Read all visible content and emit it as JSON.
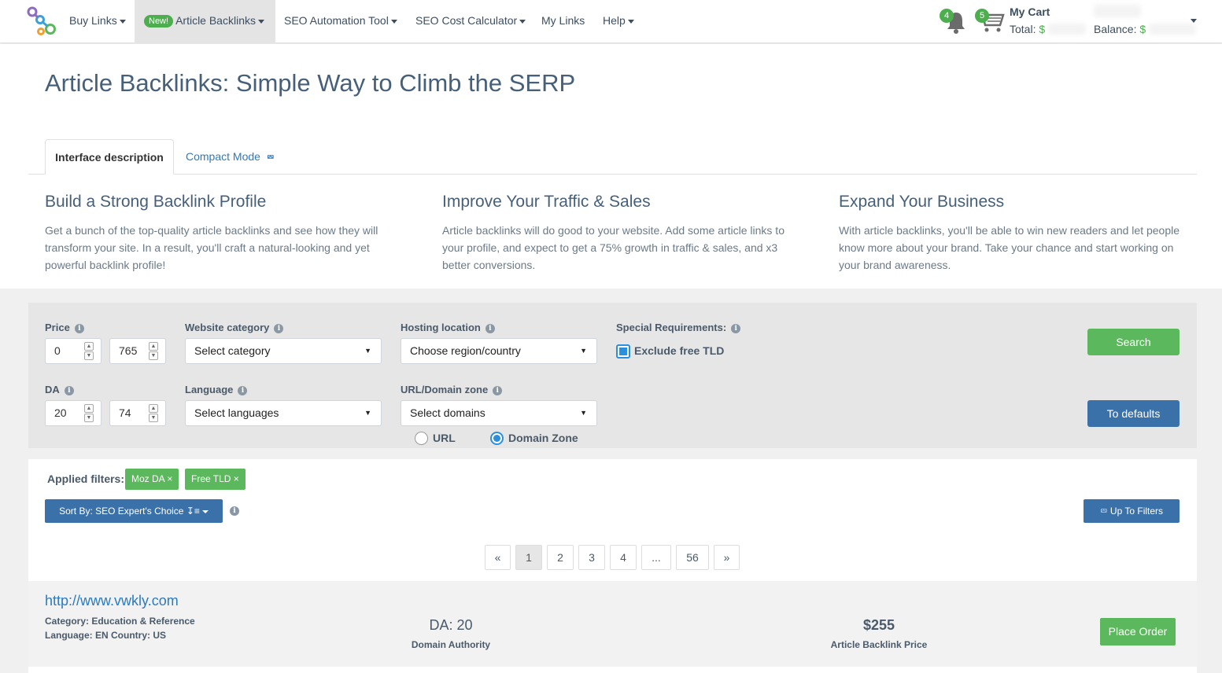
{
  "nav": {
    "items": [
      {
        "label": "Buy Links",
        "dropdown": true
      },
      {
        "badge": "New!",
        "label": "Article Backlinks",
        "dropdown": true,
        "active": true
      },
      {
        "label": "SEO Automation Tool",
        "dropdown": true
      },
      {
        "label": "SEO Cost Calculator",
        "dropdown": true
      },
      {
        "label": "My Links",
        "dropdown": false
      },
      {
        "label": "Help",
        "dropdown": true
      }
    ],
    "notifications_count": "4",
    "cart_count": "5",
    "my_cart": "My Cart",
    "total_label": "Total:",
    "currency": "$",
    "balance_label": "Balance:"
  },
  "page": {
    "title": "Article Backlinks: Simple Way to Climb the SERP",
    "tabs": {
      "active": "Interface description",
      "compact": "Compact Mode"
    },
    "columns": [
      {
        "heading": "Build a Strong Backlink Profile",
        "text": "Get a bunch of the top-quality article backlinks and see how they will transform your site. In a result, you'll craft a natural-looking and yet powerful backlink profile!"
      },
      {
        "heading": "Improve Your Traffic & Sales",
        "text": "Article backlinks will do good to your website. Add some article links to your profile, and expect to get a 75% growth in traffic & sales, and x3 better conversions."
      },
      {
        "heading": "Expand Your Business",
        "text": "With article backlinks, you'll be able to win new readers and let people know more about your brand. Take your chance and start working on your brand awareness."
      }
    ]
  },
  "filters": {
    "price_label": "Price",
    "price_min": "0",
    "price_max": "765",
    "da_label": "DA",
    "da_min": "20",
    "da_max": "74",
    "category_label": "Website category",
    "category_value": "Select category",
    "language_label": "Language",
    "language_value": "Select languages",
    "hosting_label": "Hosting location",
    "hosting_value": "Choose region/country",
    "domain_zone_label": "URL/Domain zone",
    "domain_zone_value": "Select domains",
    "radio_url": "URL",
    "radio_domain_zone": "Domain Zone",
    "radio_selected": "Domain Zone",
    "special_label": "Special Requirements:",
    "exclude_tld_label": "Exclude free TLD",
    "exclude_tld_checked": true,
    "search_button": "Search",
    "defaults_button": "To defaults"
  },
  "results": {
    "applied_label": "Applied filters:",
    "chips": [
      "Moz DA ×",
      "Free TLD ×"
    ],
    "sort_label": "Sort By: SEO Expert's Choice",
    "up_to_filters": "Up To Filters",
    "pagination": [
      "«",
      "1",
      "2",
      "3",
      "4",
      "...",
      "56",
      "»"
    ],
    "current_page": "1"
  },
  "listing": {
    "url": "http://www.vwkly.com",
    "category": "Category: Education & Reference",
    "language_country": "Language: EN Country: US",
    "da_value": "DA: 20",
    "da_caption": "Domain Authority",
    "price": "$255",
    "price_caption": "Article Backlink Price",
    "order_button": "Place Order"
  },
  "colors": {
    "accent_green": "#5cb85c",
    "accent_blue": "#3a71a8",
    "link_blue": "#2a7bbf",
    "title": "#47607a"
  }
}
